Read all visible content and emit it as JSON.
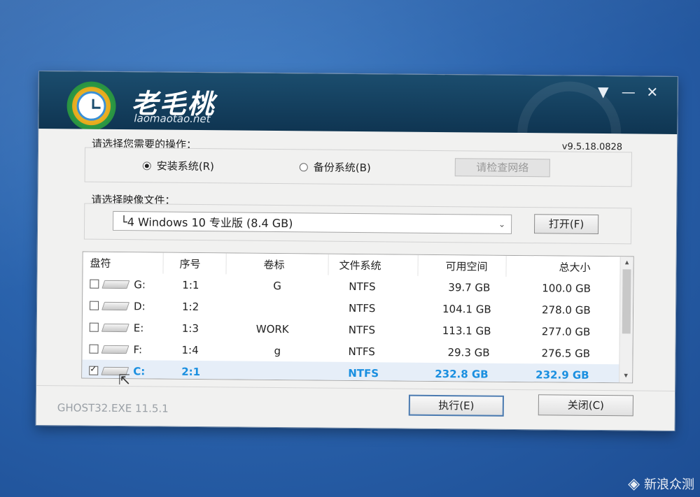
{
  "brand": {
    "name_cn": "老毛桃",
    "name_en": "laomaotao.net"
  },
  "window_controls": {
    "menu": "▼",
    "minimize": "—",
    "close": "✕"
  },
  "operation": {
    "prompt": "请选择您需要的操作：",
    "version": "v9.5.18.0828",
    "install_label": "安装系统(R)",
    "backup_label": "备份系统(B)",
    "check_network_label": "请检查网络",
    "selected": "install"
  },
  "image": {
    "prompt": "请选择映像文件：",
    "selected_value": "└4 Windows 10 专业版 (8.4 GB)",
    "open_label": "打开(F)"
  },
  "table": {
    "headers": [
      "盘符",
      "序号",
      "卷标",
      "文件系统",
      "可用空间",
      "总大小"
    ],
    "rows": [
      {
        "drive": "G:",
        "index": "1:1",
        "label": "G",
        "fs": "NTFS",
        "free": "39.7 GB",
        "total": "100.0 GB",
        "checked": false,
        "selected": false
      },
      {
        "drive": "D:",
        "index": "1:2",
        "label": "",
        "fs": "NTFS",
        "free": "104.1 GB",
        "total": "278.0 GB",
        "checked": false,
        "selected": false
      },
      {
        "drive": "E:",
        "index": "1:3",
        "label": "WORK",
        "fs": "NTFS",
        "free": "113.1 GB",
        "total": "277.0 GB",
        "checked": false,
        "selected": false
      },
      {
        "drive": "F:",
        "index": "1:4",
        "label": "g",
        "fs": "NTFS",
        "free": "29.3 GB",
        "total": "276.5 GB",
        "checked": false,
        "selected": false
      },
      {
        "drive": "C:",
        "index": "2:1",
        "label": "",
        "fs": "NTFS",
        "free": "232.8 GB",
        "total": "232.9 GB",
        "checked": true,
        "selected": true
      }
    ]
  },
  "footer": {
    "ghost_version": "GHOST32.EXE 11.5.1",
    "execute_label": "执行(E)",
    "close_label": "关闭(C)"
  },
  "watermark": {
    "text": "新浪众测"
  },
  "colors": {
    "title_bar": "#1b4d6e",
    "selected_text": "#1a8fe0",
    "desktop": "#2a63ad"
  }
}
